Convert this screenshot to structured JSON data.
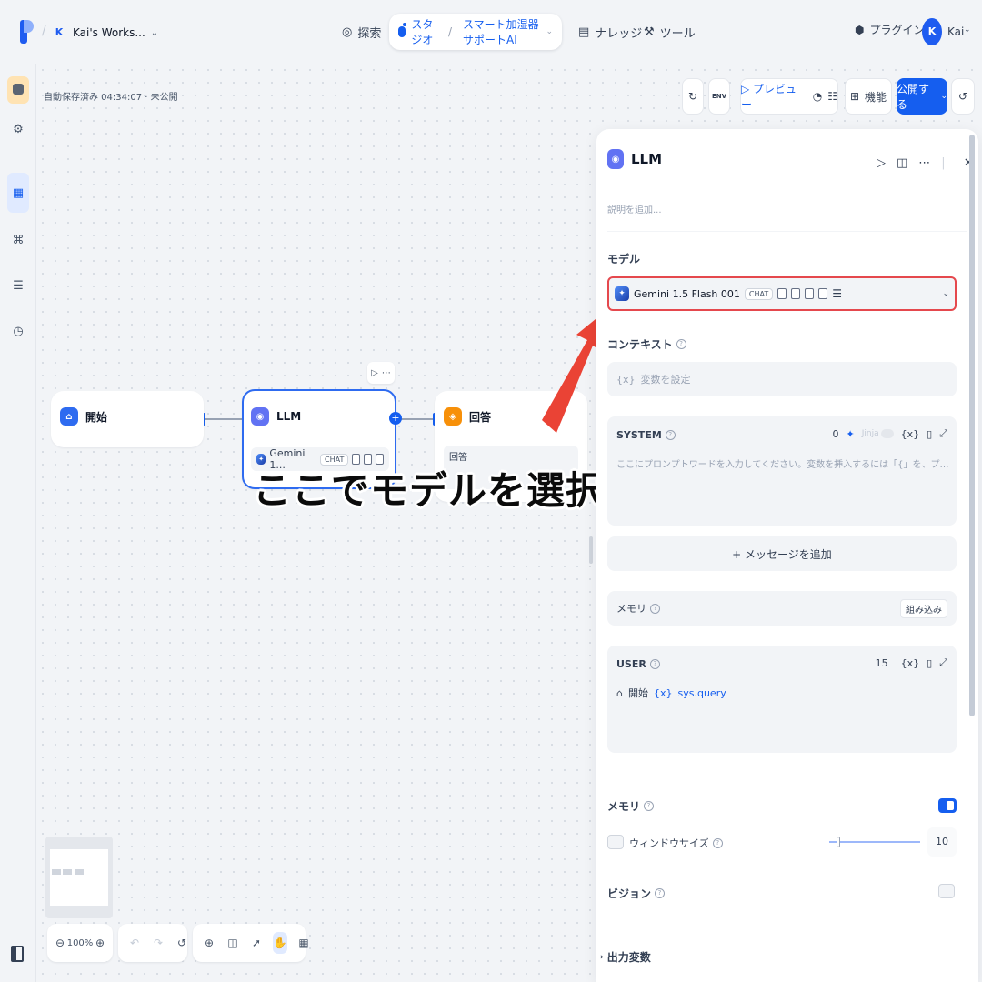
{
  "header": {
    "workspace_badge": "K",
    "workspace_name": "Kai's Works...",
    "nav": {
      "explore": "探索",
      "studio": "スタジオ",
      "app_name": "スマート加湿器サポートAI",
      "knowledge": "ナレッジ",
      "tools": "ツール"
    },
    "plugin": "プラグイン",
    "user_initial": "K",
    "user_name": "Kai"
  },
  "editor": {
    "autosave": "自動保存済み 04:34:07 · 未公開",
    "env_label": "ENV",
    "preview": "プレビュー",
    "features": "機能",
    "publish": "公開する"
  },
  "nodes": {
    "start": {
      "title": "開始"
    },
    "llm": {
      "title": "LLM",
      "model": "Gemini 1...",
      "mode": "CHAT"
    },
    "answer": {
      "title": "回答",
      "body": "回答"
    }
  },
  "annotation": "ここでモデルを選択",
  "zoom": "100%",
  "panel": {
    "title": "LLM",
    "description_placeholder": "説明を追加...",
    "model_label": "モデル",
    "model_name": "Gemini 1.5 Flash 001",
    "model_mode": "CHAT",
    "context_label": "コンテキスト",
    "context_placeholder": "変数を設定",
    "system_label": "SYSTEM",
    "system_count": "0",
    "jinja": "Jinja",
    "system_placeholder": "ここにプロンプトワードを入力してください。変数を挿入するには「{」を、プロンプトコンテンツブロックを挿入...",
    "add_message": "+ メッセージを追加",
    "memory_label": "メモリ",
    "builtin": "組み込み",
    "user_label": "USER",
    "user_count": "15",
    "user_var_node": "開始",
    "user_var": "sys.query",
    "memory_toggle_label": "メモリ",
    "window_size_label": "ウィンドウサイズ",
    "window_size_value": "10",
    "vision_label": "ビジョン",
    "output_vars": "出力変数"
  },
  "colors": {
    "accent": "#155EEF",
    "highlight": "#E5484D",
    "arrow": "#EA4335"
  },
  "icons": [
    "logo-icon",
    "explore-icon",
    "studio-icon",
    "knowledge-icon",
    "tools-icon",
    "plugin-icon",
    "home-icon",
    "gemini-icon",
    "close-icon",
    "run-icon"
  ]
}
